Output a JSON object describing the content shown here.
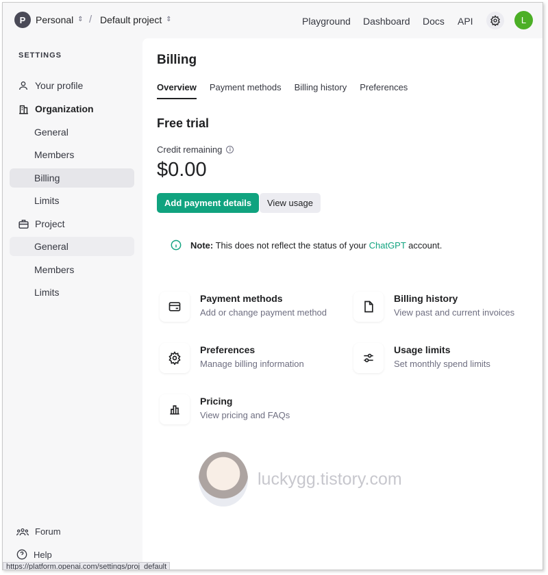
{
  "topbar": {
    "org_initial": "P",
    "org_name": "Personal",
    "separator": "/",
    "project_name": "Default project",
    "nav": [
      "Playground",
      "Dashboard",
      "Docs",
      "API"
    ],
    "user_initial": "L"
  },
  "sidebar": {
    "heading": "SETTINGS",
    "items": [
      {
        "label": "Your profile",
        "icon": "user-icon"
      },
      {
        "label": "Organization",
        "icon": "building-icon"
      },
      {
        "label": "General"
      },
      {
        "label": "Members"
      },
      {
        "label": "Billing"
      },
      {
        "label": "Limits"
      },
      {
        "label": "Project",
        "icon": "briefcase-icon"
      },
      {
        "label": "General"
      },
      {
        "label": "Members"
      },
      {
        "label": "Limits"
      }
    ],
    "footer": [
      {
        "label": "Forum",
        "icon": "people-icon"
      },
      {
        "label": "Help",
        "icon": "help-icon"
      }
    ],
    "url_hint": "https://platform.openai.com/settings/proj_default"
  },
  "main": {
    "title": "Billing",
    "tabs": [
      "Overview",
      "Payment methods",
      "Billing history",
      "Preferences"
    ],
    "section_title": "Free trial",
    "credit_label": "Credit remaining",
    "amount": "$0.00",
    "add_payment_label": "Add payment details",
    "view_usage_label": "View usage",
    "note": {
      "prefix": "Note:",
      "text": " This does not reflect the status of your ",
      "link": "ChatGPT",
      "suffix": " account."
    },
    "cards": [
      {
        "title": "Payment methods",
        "subtitle": "Add or change payment method",
        "icon": "card-icon"
      },
      {
        "title": "Billing history",
        "subtitle": "View past and current invoices",
        "icon": "document-icon"
      },
      {
        "title": "Preferences",
        "subtitle": "Manage billing information",
        "icon": "gear-icon"
      },
      {
        "title": "Usage limits",
        "subtitle": "Set monthly spend limits",
        "icon": "sliders-icon"
      },
      {
        "title": "Pricing",
        "subtitle": "View pricing and FAQs",
        "icon": "bar-chart-icon"
      }
    ],
    "watermark": "luckygg.tistory.com"
  },
  "colors": {
    "accent": "#10a37f",
    "avatar_user": "#4caf26",
    "avatar_org": "#4a4a57"
  }
}
